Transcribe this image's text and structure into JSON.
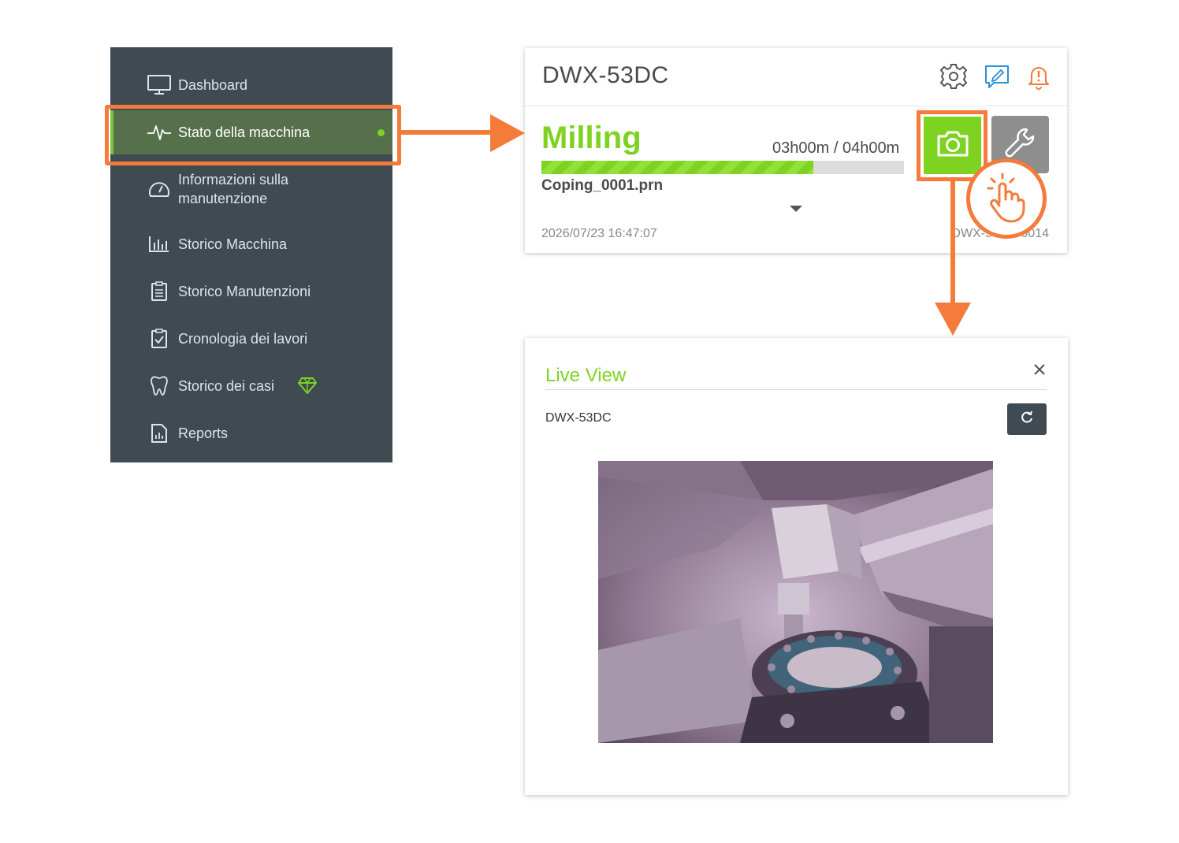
{
  "sidebar": {
    "items": [
      {
        "label": "Dashboard",
        "icon": "monitor-icon"
      },
      {
        "label": "Stato della macchina",
        "icon": "pulse-icon",
        "active": true
      },
      {
        "label": "Informazioni sulla manutenzione",
        "icon": "gauge-icon"
      },
      {
        "label": "Storico Macchina",
        "icon": "bar-chart-icon"
      },
      {
        "label": "Storico Manutenzioni",
        "icon": "clipboard-list-icon"
      },
      {
        "label": "Cronologia dei lavori",
        "icon": "clipboard-check-icon"
      },
      {
        "label": "Storico dei casi",
        "icon": "tooth-icon",
        "badge": "diamond-icon"
      },
      {
        "label": "Reports",
        "icon": "report-icon"
      }
    ]
  },
  "machine_card": {
    "title": "DWX-53DC",
    "status": "Milling",
    "time": "03h00m / 04h00m",
    "progress": 0.75,
    "file": "Coping_0001.prn",
    "date": "2026/07/23 16:47:07",
    "serial": "DWX-53DC 0014"
  },
  "live_view": {
    "title": "Live View",
    "device": "DWX-53DC"
  },
  "colors": {
    "accent_green": "#7ed321",
    "highlight_orange": "#f47b3a",
    "sidebar_bg": "#3f4a52"
  }
}
